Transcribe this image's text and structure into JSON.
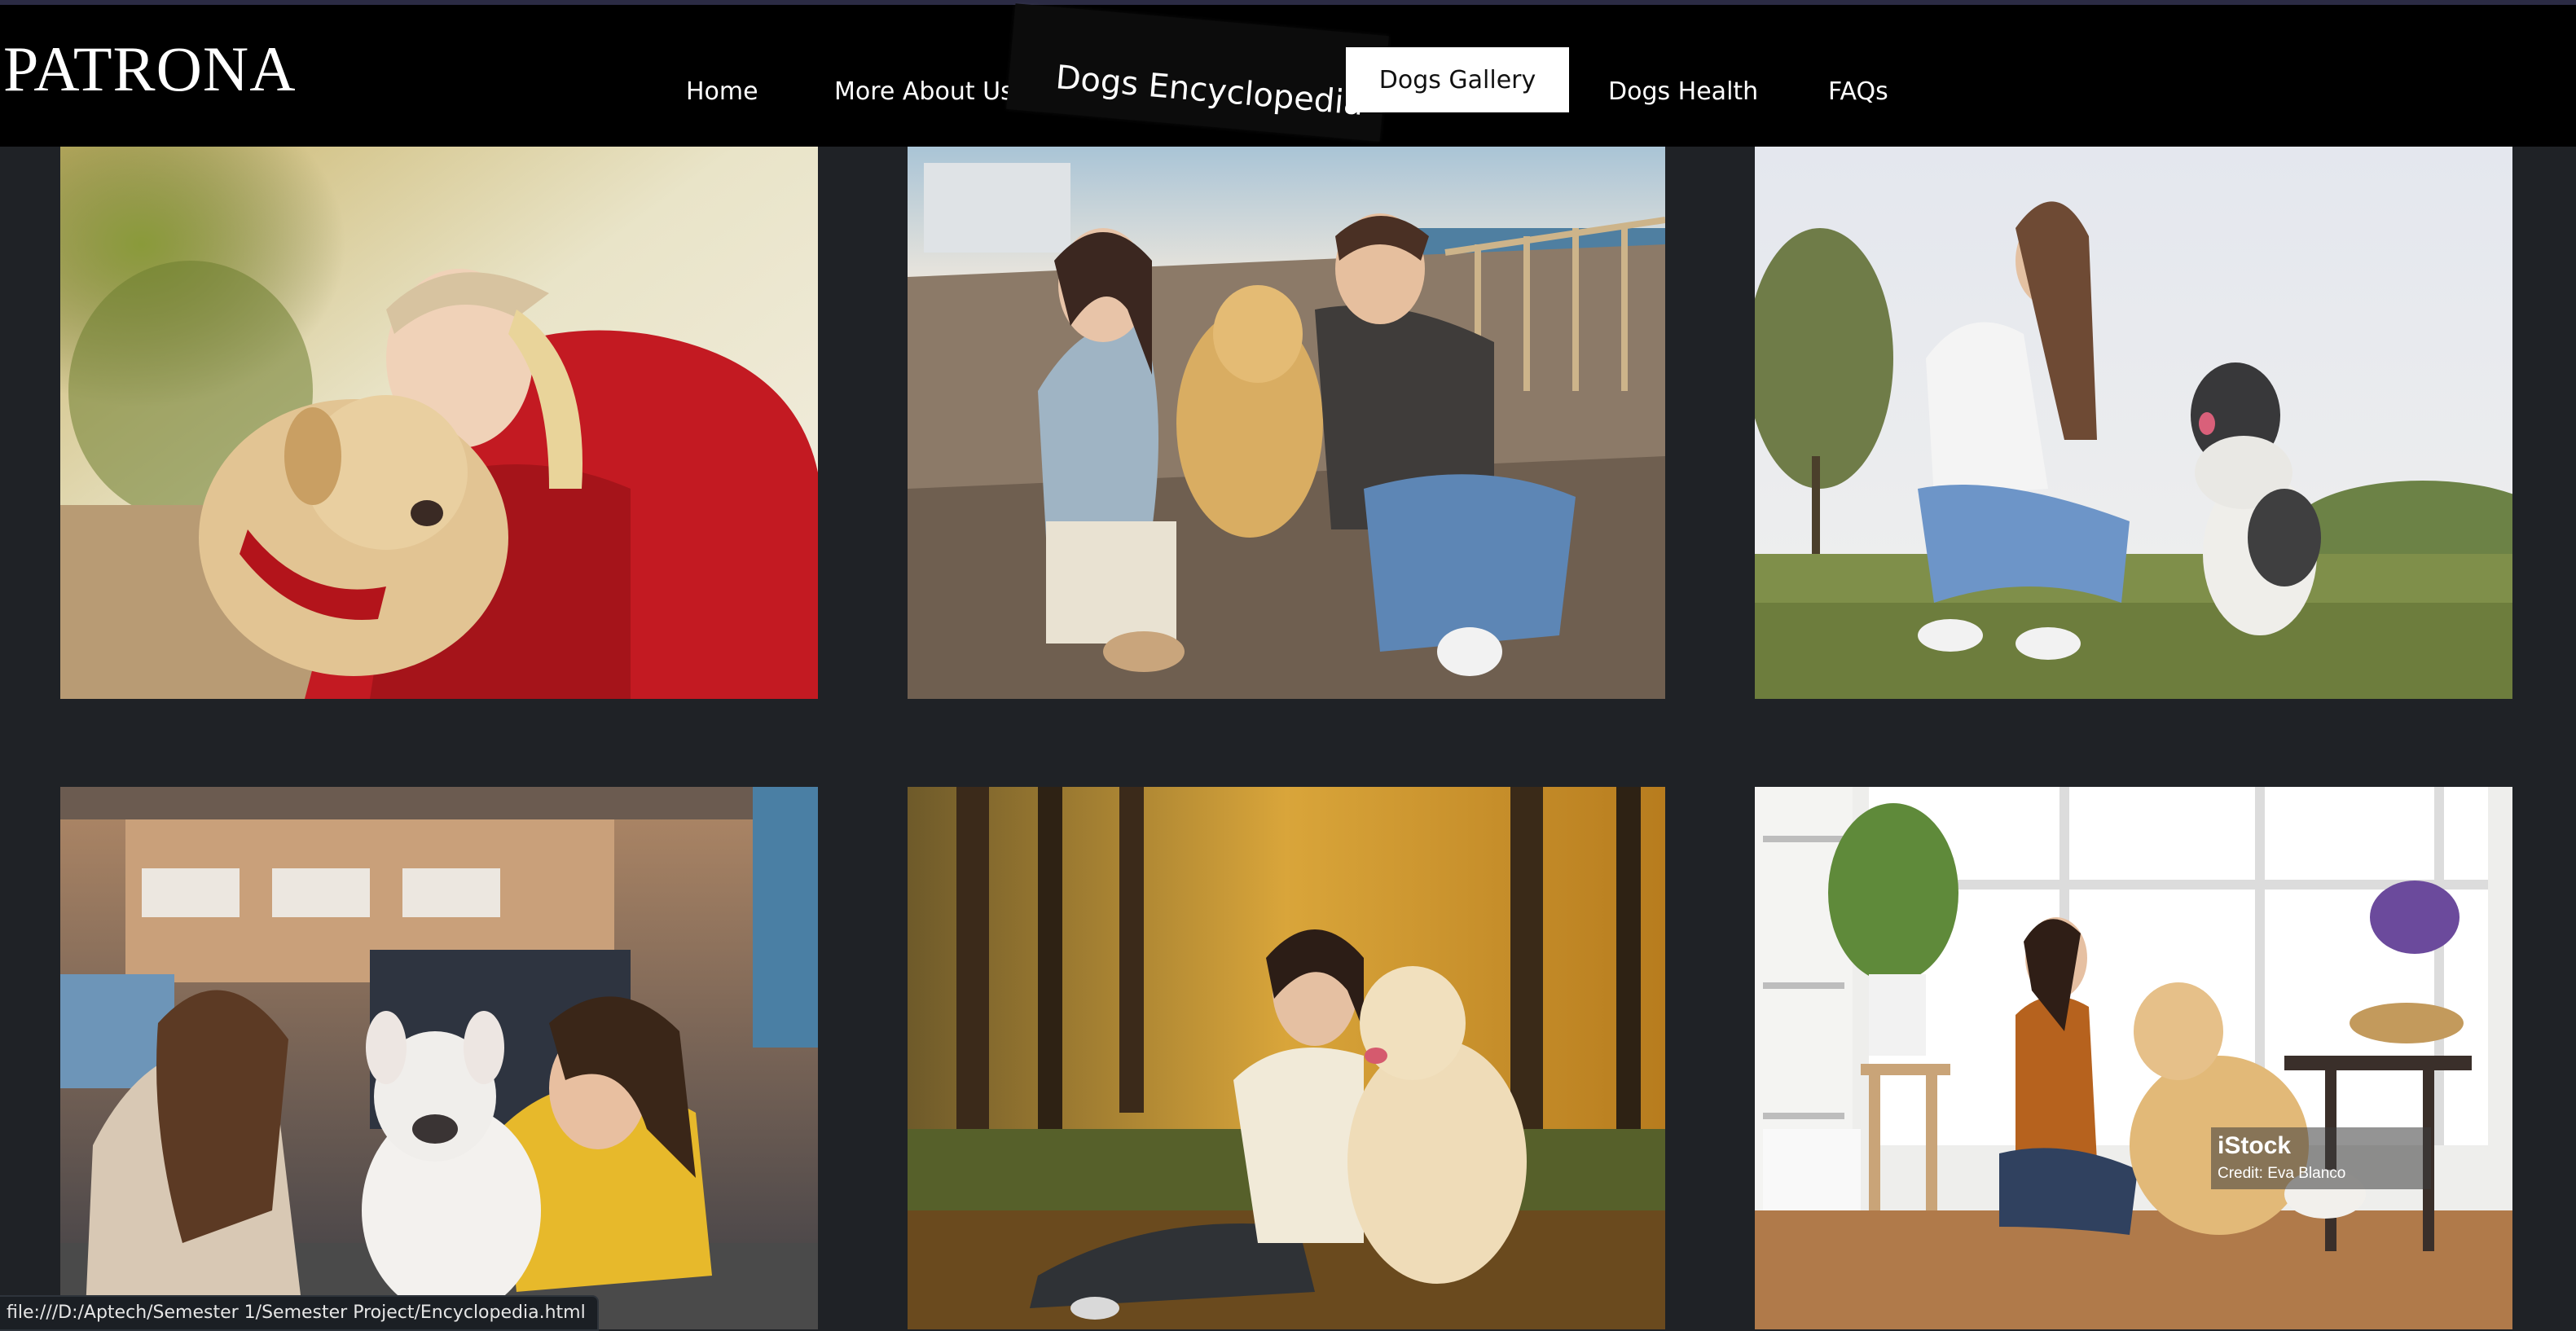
{
  "brand": {
    "name": "PATRONA"
  },
  "nav": {
    "home": "Home",
    "about": "More About Us",
    "encyclopedia": "Dogs Encyclopedia",
    "gallery": "Dogs Gallery",
    "health": "Dogs Health",
    "faqs": "FAQs",
    "active": "Dogs Gallery"
  },
  "gallery": {
    "photos": [
      {
        "subject": "woman-in-red-sweater-with-labrador"
      },
      {
        "subject": "couple-with-golden-retriever-on-boardwalk"
      },
      {
        "subject": "woman-training-fluffy-dog-in-park"
      },
      {
        "subject": "two-girls-with-french-bulldog"
      },
      {
        "subject": "woman-with-golden-retriever-in-autumn-forest"
      },
      {
        "subject": "woman-high-five-golden-retriever-at-home"
      }
    ],
    "watermark": {
      "logo": "iStock",
      "credit": "Credit: Eva Blanco"
    }
  },
  "status": {
    "url": "file:///D:/Aptech/Semester 1/Semester Project/Encyclopedia.html"
  },
  "colors": {
    "page_background": "#1f2226",
    "navbar_background": "#000000",
    "active_tab_background": "#ffffff",
    "nav_text": "#ffffff"
  }
}
